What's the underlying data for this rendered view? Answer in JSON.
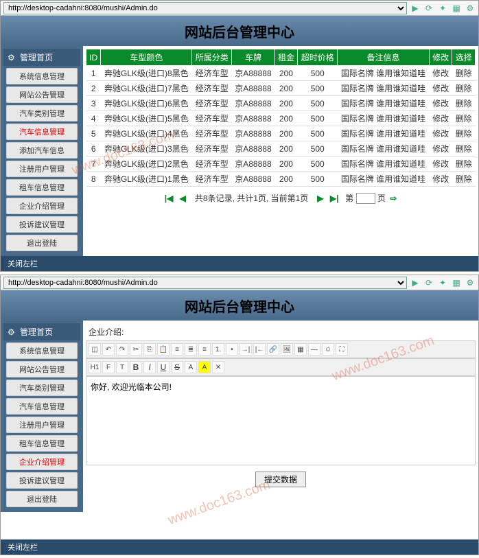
{
  "url": "http://desktop-cadahni:8080/mushi/Admin.do",
  "watermark": "www.doc163.com",
  "header_title": "网站后台管理中心",
  "close_left": "关闭左栏",
  "shot1": {
    "sidebar_title": "管理首页",
    "menu": [
      {
        "label": "系统信息管理",
        "active": false
      },
      {
        "label": "网站公告管理",
        "active": false
      },
      {
        "label": "汽车类别管理",
        "active": false
      },
      {
        "label": "汽车信息管理",
        "active": true
      },
      {
        "label": "添加汽车信息",
        "active": false
      },
      {
        "label": "注册用户管理",
        "active": false
      },
      {
        "label": "租车信息管理",
        "active": false
      },
      {
        "label": "企业介绍管理",
        "active": false
      },
      {
        "label": "投诉建议管理",
        "active": false
      },
      {
        "label": "退出登陆",
        "active": false
      }
    ],
    "columns": [
      "ID",
      "车型颜色",
      "所属分类",
      "车牌",
      "租金",
      "超时价格",
      "备注信息",
      "修改",
      "选择"
    ],
    "rows": [
      {
        "id": 1,
        "model": "奔驰GLK级(进口)8黑色",
        "cat": "经济车型",
        "plate": "京A88888",
        "rent": 200,
        "over": 500,
        "note": "国际名牌 谁用谁知道哇",
        "edit": "修改",
        "del": "删除"
      },
      {
        "id": 2,
        "model": "奔驰GLK级(进口)7黑色",
        "cat": "经济车型",
        "plate": "京A88888",
        "rent": 200,
        "over": 500,
        "note": "国际名牌 谁用谁知道哇",
        "edit": "修改",
        "del": "删除"
      },
      {
        "id": 3,
        "model": "奔驰GLK级(进口)6黑色",
        "cat": "经济车型",
        "plate": "京A88888",
        "rent": 200,
        "over": 500,
        "note": "国际名牌 谁用谁知道哇",
        "edit": "修改",
        "del": "删除"
      },
      {
        "id": 4,
        "model": "奔驰GLK级(进口)5黑色",
        "cat": "经济车型",
        "plate": "京A88888",
        "rent": 200,
        "over": 500,
        "note": "国际名牌 谁用谁知道哇",
        "edit": "修改",
        "del": "删除"
      },
      {
        "id": 5,
        "model": "奔驰GLK级(进口)4黑色",
        "cat": "经济车型",
        "plate": "京A88888",
        "rent": 200,
        "over": 500,
        "note": "国际名牌 谁用谁知道哇",
        "edit": "修改",
        "del": "删除"
      },
      {
        "id": 6,
        "model": "奔驰GLK级(进口)3黑色",
        "cat": "经济车型",
        "plate": "京A88888",
        "rent": 200,
        "over": 500,
        "note": "国际名牌 谁用谁知道哇",
        "edit": "修改",
        "del": "删除"
      },
      {
        "id": 7,
        "model": "奔驰GLK级(进口)2黑色",
        "cat": "经济车型",
        "plate": "京A88888",
        "rent": 200,
        "over": 500,
        "note": "国际名牌 谁用谁知道哇",
        "edit": "修改",
        "del": "删除"
      },
      {
        "id": 8,
        "model": "奔驰GLK级(进口)1黑色",
        "cat": "经济车型",
        "plate": "京A88888",
        "rent": 200,
        "over": 500,
        "note": "国际名牌 谁用谁知道哇",
        "edit": "修改",
        "del": "删除"
      }
    ],
    "pager_text": "共8条记录, 共计1页, 当前第1页",
    "pager_di": "第",
    "pager_ye": "页"
  },
  "shot2": {
    "sidebar_title": "管理首页",
    "menu": [
      {
        "label": "系统信息管理",
        "active": false
      },
      {
        "label": "网站公告管理",
        "active": false
      },
      {
        "label": "汽车类别管理",
        "active": false
      },
      {
        "label": "汽车信息管理",
        "active": false
      },
      {
        "label": "注册用户管理",
        "active": false
      },
      {
        "label": "租车信息管理",
        "active": false
      },
      {
        "label": "企业介绍管理",
        "active": true
      },
      {
        "label": "投诉建议管理",
        "active": false
      },
      {
        "label": "退出登陆",
        "active": false
      }
    ],
    "editor_label": "企业介绍:",
    "editor_content": "你好, 欢迎光临本公司!",
    "submit_label": "提交数据"
  }
}
